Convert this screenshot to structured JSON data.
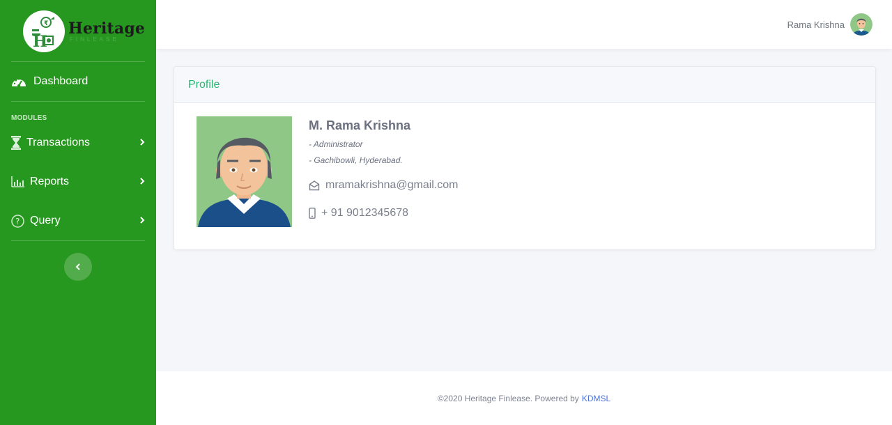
{
  "brand": {
    "name": "Heritage",
    "sub": "FINLEASE"
  },
  "sidebar": {
    "dashboard_label": "Dashboard",
    "modules_heading": "MODULES",
    "items": [
      {
        "label": "Transactions",
        "icon": "hourglass-icon"
      },
      {
        "label": "Reports",
        "icon": "bar-chart-icon"
      },
      {
        "label": "Query",
        "icon": "question-circle-icon"
      }
    ]
  },
  "topbar": {
    "user_name": "Rama Krishna"
  },
  "profile": {
    "title": "Profile",
    "name": "M. Rama Krishna",
    "role": "- Administrator",
    "location": "- Gachibowli, Hyderabad.",
    "email": "mramakrishna@gmail.com",
    "phone": "+ 91 9012345678"
  },
  "footer": {
    "copyright": "©2020 Heritage Finlease. Powered by",
    "link": "KDMSL"
  },
  "colors": {
    "sidebar": "#27981f",
    "accent": "#2bb673",
    "link": "#4b72d9"
  }
}
